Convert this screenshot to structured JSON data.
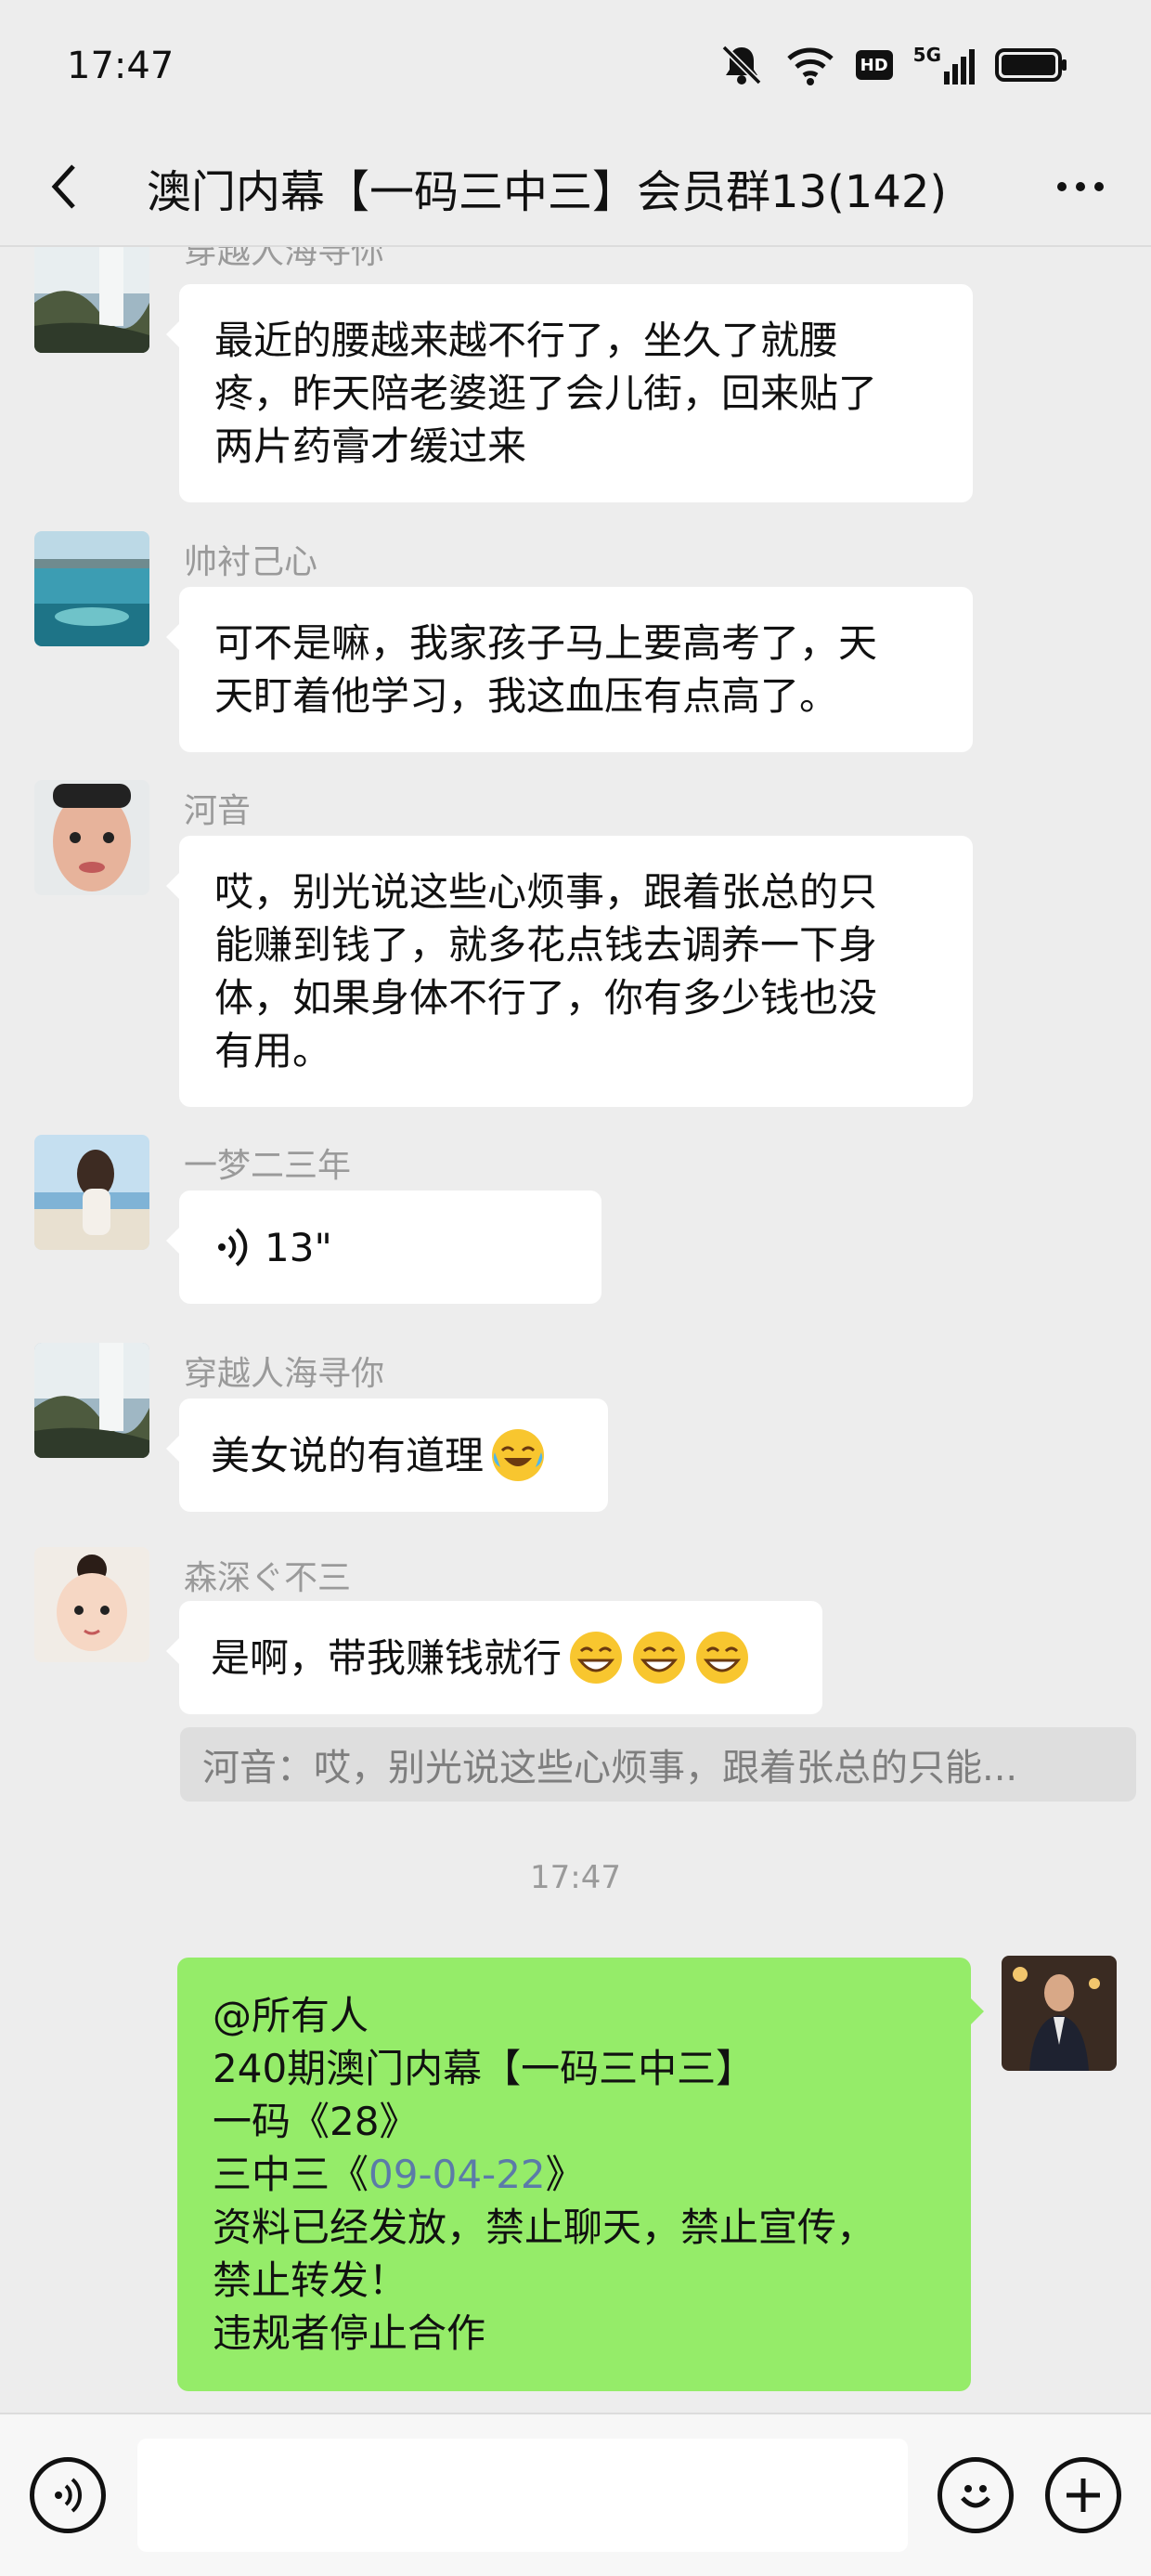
{
  "status_bar": {
    "time": "17:47",
    "icons": [
      "mute-bell-icon",
      "wifi-icon",
      "hd-icon",
      "5g-signal-icon",
      "battery-icon"
    ],
    "hd_label": "HD",
    "net_label": "5G"
  },
  "nav": {
    "title": "澳门内幕【一码三中三】会员群13(142)"
  },
  "messages": [
    {
      "sender": "穿越人海寻你",
      "lines": [
        "最近的腰越来越不行了，坐久了就腰",
        "疼，昨天陪老婆逛了会儿街，回来贴了",
        "两片药膏才缓过来"
      ]
    },
    {
      "sender": "帅衬己心",
      "lines": [
        "可不是嘛，我家孩子马上要高考了，天",
        "天盯着他学习，我这血压有点高了。"
      ]
    },
    {
      "sender": "河音",
      "lines": [
        "哎，别光说这些心烦事，跟着张总的只",
        "能赚到钱了，就多花点钱去调养一下身",
        "体，如果身体不行了，你有多少钱也没",
        "有用。"
      ]
    },
    {
      "sender": "一梦二三年",
      "voice_duration": "13\""
    },
    {
      "sender": "穿越人海寻你",
      "text": "美女说的有道理",
      "emoji": [
        "laughing-crying-emoji"
      ]
    },
    {
      "sender": "森深ぐ不三",
      "text": "是啊，带我赚钱就行",
      "emoji": [
        "grinning-emoji",
        "grinning-emoji",
        "grinning-emoji"
      ]
    }
  ],
  "quote": "河音：哎，别光说这些心烦事，跟着张总的只能...",
  "timestamp": "17:47",
  "my_message": {
    "line1": "@所有人",
    "line2": "240期澳门内幕【一码三中三】",
    "line3": "一码《28》",
    "line4_prefix": "三中三《",
    "line4_link": "09-04-22",
    "line4_suffix": "》",
    "line5": "资料已经发放，禁止聊天，禁止宣传，",
    "line6": "禁止转发！",
    "line7": "违规者停止合作"
  },
  "input_bar": {
    "voice_button": "voice-icon",
    "emoji_button": "smiley-icon",
    "plus_button": "plus-icon",
    "input_value": ""
  },
  "colors": {
    "background": "#ededed",
    "my_bubble": "#95ec69",
    "other_bubble": "#ffffff",
    "link": "#5b7ba8",
    "nickname": "#9a9a9a"
  }
}
